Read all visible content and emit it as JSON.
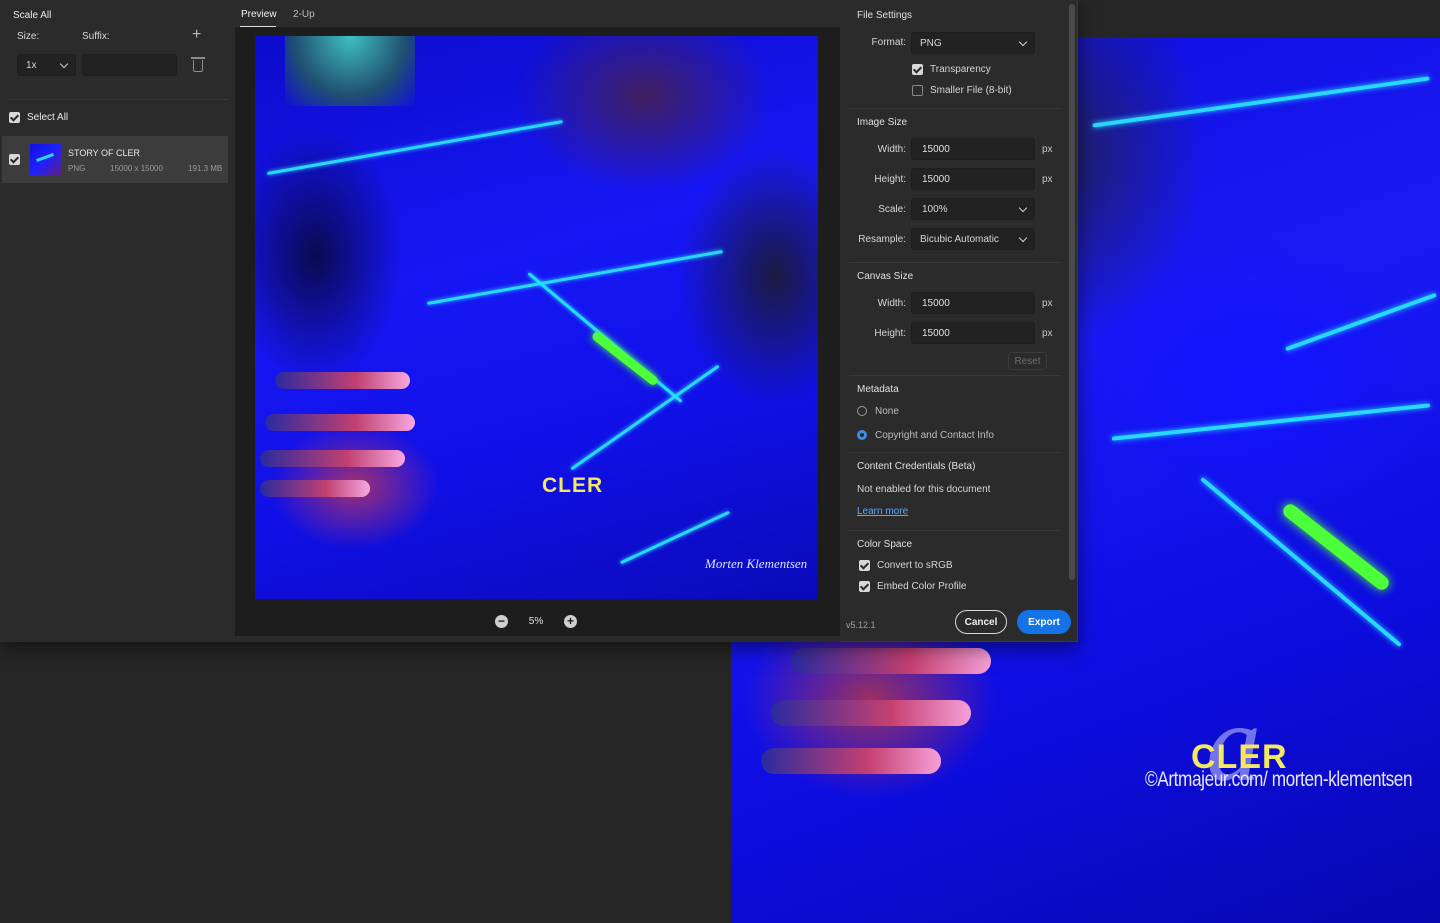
{
  "colors": {
    "accent": "#1473e6",
    "link": "#5aa9ff",
    "dialog_bg": "#2b2b2b",
    "preview_bg": "#1d1d1d",
    "art_blue": "#1717f5",
    "art_title": "#f4e860"
  },
  "left": {
    "scale_all": "Scale All",
    "size_label": "Size:",
    "suffix_label": "Suffix:",
    "size_value": "1x",
    "suffix_value": "",
    "select_all": "Select All",
    "file": {
      "name": "STORY OF CLER",
      "format": "PNG",
      "dimensions": "15000 x 15000",
      "size": "191.3 MB"
    }
  },
  "tabs": [
    {
      "label": "Preview"
    },
    {
      "label": "2-Up"
    }
  ],
  "preview": {
    "art_title": "CLER",
    "art_signature": "Morten Klementsen",
    "zoom": "5%"
  },
  "settings": {
    "file_settings": "File Settings",
    "format_label": "Format:",
    "format_value": "PNG",
    "transparency": "Transparency",
    "smaller_file": "Smaller File (8-bit)",
    "image_size": "Image Size",
    "width_label": "Width:",
    "height_label": "Height:",
    "scale_label": "Scale:",
    "resample_label": "Resample:",
    "img_width": "15000",
    "img_height": "15000",
    "scale_value": "100%",
    "resample_value": "Bicubic Automatic",
    "unit_px": "px",
    "canvas_size": "Canvas Size",
    "canvas_width": "15000",
    "canvas_height": "15000",
    "reset": "Reset",
    "metadata": "Metadata",
    "meta_none": "None",
    "meta_copyright": "Copyright and Contact Info",
    "content_credentials": "Content Credentials (Beta)",
    "cc_status": "Not enabled for this document",
    "learn_more": "Learn more",
    "color_space": "Color Space",
    "convert_srgb": "Convert to sRGB",
    "embed_profile": "Embed Color Profile"
  },
  "footer": {
    "version": "v5.12.1",
    "cancel": "Cancel",
    "export": "Export"
  },
  "background": {
    "title": "CLER",
    "watermark": "©Artmajeur.com/ morten-klementsen",
    "logo": "a"
  }
}
